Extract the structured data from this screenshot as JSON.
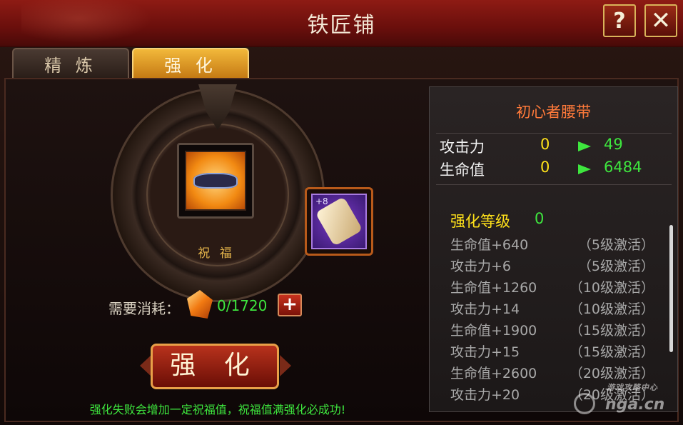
{
  "window": {
    "title": "铁匠铺",
    "help_icon": "?",
    "close_icon": "✕"
  },
  "tabs": [
    {
      "label": "精 炼",
      "active": false
    },
    {
      "label": "强 化",
      "active": true
    }
  ],
  "forge": {
    "main_item_icon": "belt-icon",
    "bless_label": "祝 福",
    "scroll_badge": "+8",
    "scroll_icon": "scroll-icon",
    "cost_label": "需要消耗：",
    "cost_icon": "crystal-icon",
    "cost_value": "0/1720",
    "add_label": "+",
    "enhance_button": "强 化",
    "hint": "强化失败会增加一定祝福值，祝福值满强化必成功!"
  },
  "info": {
    "item_name": "初心者腰带",
    "stats": [
      {
        "name": "攻击力",
        "current": "0",
        "next": "49"
      },
      {
        "name": "生命值",
        "current": "0",
        "next": "6484"
      }
    ],
    "level_label": "强化等级",
    "level_value": "0",
    "bonuses": [
      {
        "bonus": "生命值+640",
        "activate": "（5级激活）"
      },
      {
        "bonus": "攻击力+6",
        "activate": "（5级激活）"
      },
      {
        "bonus": "生命值+1260",
        "activate": "（10级激活）"
      },
      {
        "bonus": "攻击力+14",
        "activate": "（10级激活）"
      },
      {
        "bonus": "生命值+1900",
        "activate": "（15级激活）"
      },
      {
        "bonus": "攻击力+15",
        "activate": "（15级激活）"
      },
      {
        "bonus": "生命值+2600",
        "activate": "（20级激活）"
      },
      {
        "bonus": "攻击力+20",
        "activate": "（20级激活）"
      }
    ]
  },
  "watermark": {
    "top": "游戏攻略中心",
    "main": "nga.cn"
  },
  "colors": {
    "accent_gold": "#f2b83a",
    "stat_green": "#3ee63e",
    "stat_yellow": "#ffe21a",
    "item_orange": "#ff7a3a",
    "title_red": "#8e1b14"
  }
}
